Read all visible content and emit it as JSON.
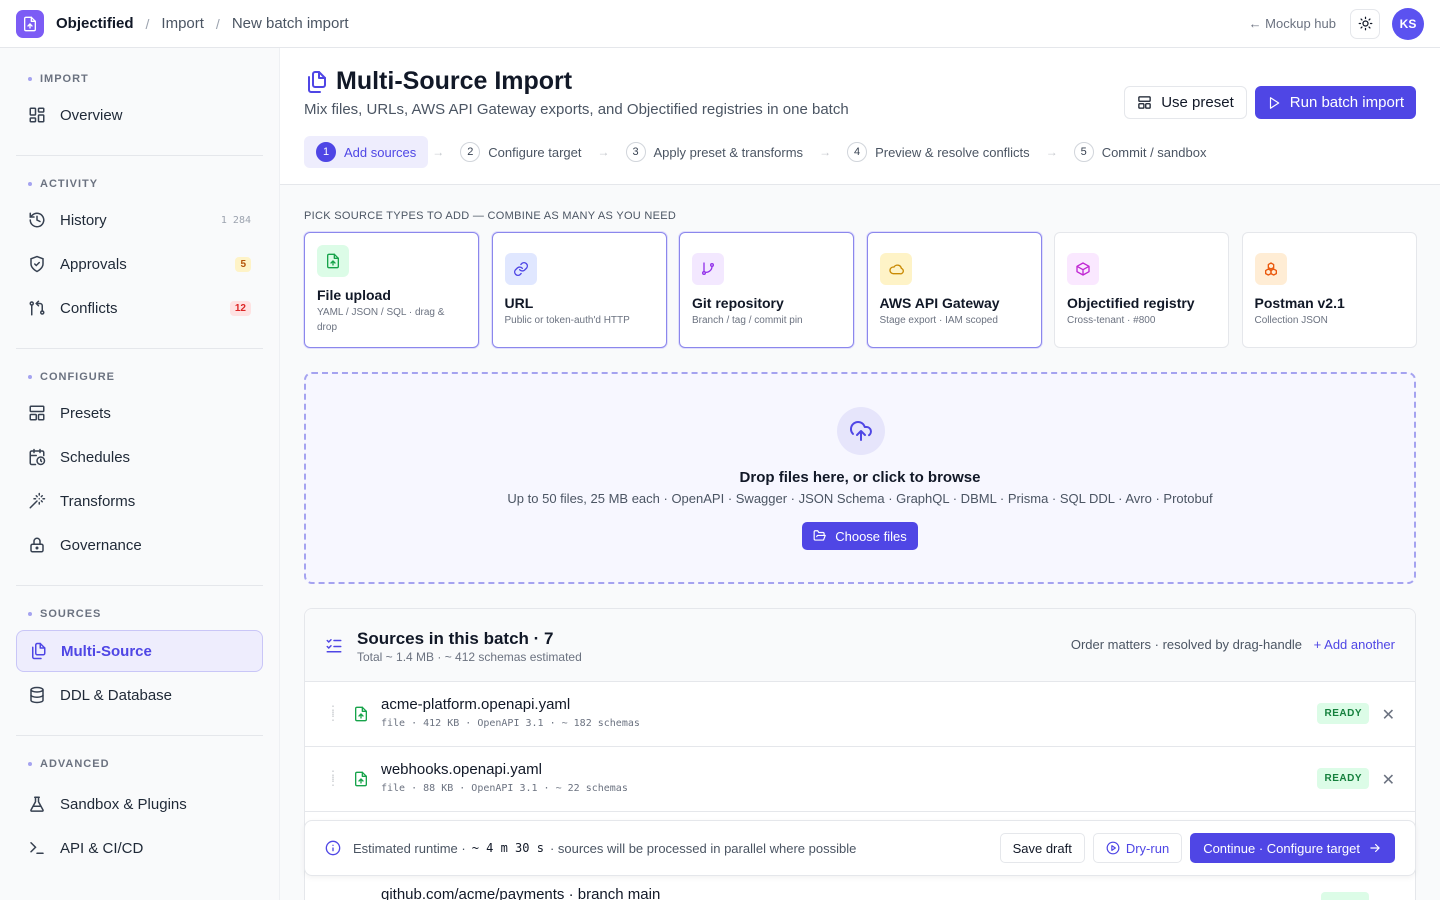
{
  "topbar": {
    "brand": "Objectified",
    "breadcrumbs": [
      "Import",
      "New batch import"
    ],
    "separator": "/",
    "hub_link": "← Mockup hub",
    "avatar_initials": "KS"
  },
  "sidebar": {
    "sections": [
      {
        "title": "IMPORT",
        "items": [
          {
            "label": "Overview",
            "icon": "grid-icon"
          }
        ]
      },
      {
        "title": "ACTIVITY",
        "items": [
          {
            "label": "History",
            "icon": "history-icon",
            "count": "1 284"
          },
          {
            "label": "Approvals",
            "icon": "shield-check-icon",
            "badge": "5"
          },
          {
            "label": "Conflicts",
            "icon": "git-compare-icon",
            "badge": "12"
          }
        ]
      },
      {
        "title": "CONFIGURE",
        "items": [
          {
            "label": "Presets",
            "icon": "layout-icon"
          },
          {
            "label": "Schedules",
            "icon": "calendar-clock-icon"
          },
          {
            "label": "Transforms",
            "icon": "wand-icon"
          },
          {
            "label": "Governance",
            "icon": "lock-icon"
          }
        ]
      },
      {
        "title": "SOURCES",
        "items": [
          {
            "label": "Multi-Source",
            "icon": "files-icon",
            "active": true
          },
          {
            "label": "DDL & Database",
            "icon": "database-icon"
          }
        ]
      },
      {
        "title": "ADVANCED",
        "items": [
          {
            "label": "Sandbox & Plugins",
            "icon": "flask-icon"
          },
          {
            "label": "API & CI/CD",
            "icon": "terminal-icon"
          }
        ]
      }
    ]
  },
  "header": {
    "title": "Multi-Source Import",
    "subtitle": "Mix files, URLs, AWS API Gateway exports, and Objectified registries in one batch",
    "use_preset": "Use preset",
    "run_batch": "Run batch import",
    "steps": [
      {
        "num": "1",
        "label": "Add sources"
      },
      {
        "num": "2",
        "label": "Configure target"
      },
      {
        "num": "3",
        "label": "Apply preset & transforms"
      },
      {
        "num": "4",
        "label": "Preview & resolve conflicts"
      },
      {
        "num": "5",
        "label": "Commit / sandbox"
      }
    ],
    "step_arrow": "→"
  },
  "pick_label": "PICK SOURCE TYPES TO ADD — COMBINE AS MANY AS YOU NEED",
  "source_types": [
    {
      "title": "File upload",
      "sub": "YAML / JSON / SQL · drag & drop",
      "icon": "file-upload-icon",
      "color": "#16a34a",
      "bg": "#dcfce7",
      "selected": true
    },
    {
      "title": "URL",
      "sub": "Public or token-auth'd HTTP",
      "icon": "link-icon",
      "color": "#4f46e5",
      "bg": "#e0e7ff",
      "selected": true
    },
    {
      "title": "Git repository",
      "sub": "Branch / tag / commit pin",
      "icon": "git-branch-icon",
      "color": "#9333ea",
      "bg": "#f3e8ff",
      "selected": true
    },
    {
      "title": "AWS API Gateway",
      "sub": "Stage export · IAM scoped",
      "icon": "cloud-icon",
      "color": "#ca8a04",
      "bg": "#fef3c7",
      "selected": true
    },
    {
      "title": "Objectified registry",
      "sub": "Cross-tenant · #800",
      "icon": "box-icon",
      "color": "#c026d3",
      "bg": "#fae8ff",
      "selected": false
    },
    {
      "title": "Postman v2.1",
      "sub": "Collection JSON",
      "icon": "blocks-icon",
      "color": "#ea580c",
      "bg": "#ffedd5",
      "selected": false
    }
  ],
  "dropzone": {
    "title": "Drop files here, or click to browse",
    "sub": "Up to 50 files, 25 MB each · OpenAPI · Swagger · JSON Schema · GraphQL · DBML · Prisma · SQL DDL · Avro · Protobuf",
    "button": "Choose files"
  },
  "batch": {
    "title": "Sources in this batch · 7",
    "sub": "Total ~ 1.4 MB · ~ 412 schemas estimated",
    "order_note": "Order matters · resolved by drag-handle",
    "add_another": "+ Add another",
    "rows": [
      {
        "name": "acme-platform.openapi.yaml",
        "meta": "file · 412 KB · OpenAPI 3.1 · ~ 182 schemas",
        "status": "READY"
      },
      {
        "name": "webhooks.openapi.yaml",
        "meta": "file · 88 KB · OpenAPI 3.1 · ~ 22 schemas",
        "status": "READY"
      }
    ],
    "partial_row": "github.com/acme/payments · branch main",
    "remove_glyph": "✕"
  },
  "footer": {
    "prefix": "Estimated runtime ·",
    "runtime": "~ 4 m 30 s",
    "suffix": "· sources will be processed in parallel where possible",
    "save_draft": "Save draft",
    "dry_run": "Dry-run",
    "continue": "Continue · Configure target"
  }
}
